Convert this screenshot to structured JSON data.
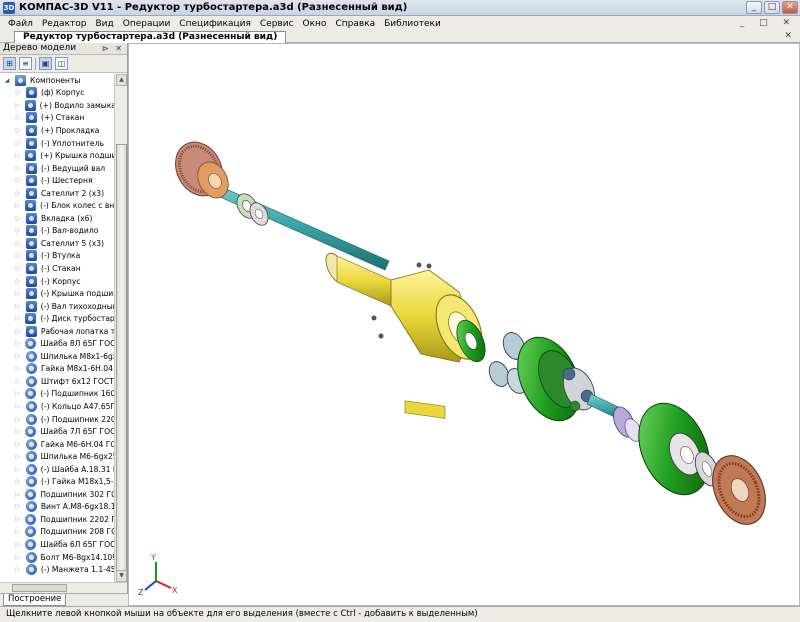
{
  "window": {
    "title": "КОМПАС-3D V11 - Редуктор турбостартера.a3d (Разнесенный вид)",
    "icon_label": "3D",
    "controls": [
      "minimize-icon",
      "maximize-icon",
      "close-icon"
    ]
  },
  "menu": [
    "Файл",
    "Редактор",
    "Вид",
    "Операции",
    "Спецификация",
    "Сервис",
    "Окно",
    "Справка",
    "Библиотеки"
  ],
  "document_tab": {
    "label": "Редуктор турбостартера.a3d (Разнесенный вид)"
  },
  "model_tree": {
    "header": "Дерево модели",
    "root": "Компоненты",
    "items": [
      {
        "label": "(ф) Корпус",
        "icon": "part-icon"
      },
      {
        "label": "(+) Водило замыкающ",
        "icon": "part-icon"
      },
      {
        "label": "(+) Стакан",
        "icon": "part-icon"
      },
      {
        "label": "(+) Прокладка",
        "icon": "part-icon"
      },
      {
        "label": "(-) Уплотнитель",
        "icon": "part-icon"
      },
      {
        "label": "(+) Крышка подшип",
        "icon": "part-icon"
      },
      {
        "label": "(-) Ведущий вал",
        "icon": "part-icon"
      },
      {
        "label": "(-) Шестерня",
        "icon": "part-icon"
      },
      {
        "label": "Сателлит 2 (x3)",
        "icon": "part-icon"
      },
      {
        "label": "(-) Блок колес с внут",
        "icon": "part-icon"
      },
      {
        "label": "Вкладка (x6)",
        "icon": "part-icon"
      },
      {
        "label": "(-) Вал-водило",
        "icon": "part-icon"
      },
      {
        "label": "Сателлит 5 (x3)",
        "icon": "part-icon"
      },
      {
        "label": "(-) Втулка",
        "icon": "part-icon"
      },
      {
        "label": "(-) Стакан",
        "icon": "part-icon"
      },
      {
        "label": "(-) Корпус",
        "icon": "part-icon"
      },
      {
        "label": "(-) Крышка подшип",
        "icon": "part-icon"
      },
      {
        "label": "(-) Вал тихоходный",
        "icon": "part-icon"
      },
      {
        "label": "(-) Диск турбостарт",
        "icon": "part-icon"
      },
      {
        "label": "Рабочая лопатка т",
        "icon": "part-icon"
      },
      {
        "label": "Шайба 8Л 65Г ГОСТ",
        "icon": "standard-part-icon"
      },
      {
        "label": "Шпилька М8х1-6gх",
        "icon": "standard-part-icon"
      },
      {
        "label": "Гайка М8х1-6Н.04",
        "icon": "standard-part-icon"
      },
      {
        "label": "Штифт 6х12 ГОСТ",
        "icon": "standard-part-icon"
      },
      {
        "label": "(-) Подшипник 1602",
        "icon": "standard-part-icon"
      },
      {
        "label": "(-) Кольцо А47.65Г",
        "icon": "standard-part-icon"
      },
      {
        "label": "(-) Подшипник 220",
        "icon": "standard-part-icon"
      },
      {
        "label": "Шайба 7Л 65Г ГОСТ",
        "icon": "standard-part-icon"
      },
      {
        "label": "Гайка М6-6Н.04 ГО",
        "icon": "standard-part-icon"
      },
      {
        "label": "Шпилька М6-6gх25",
        "icon": "standard-part-icon"
      },
      {
        "label": "(-) Шайба А.18.31 Г",
        "icon": "standard-part-icon"
      },
      {
        "label": "(-) Гайка М18х1,5-",
        "icon": "standard-part-icon"
      },
      {
        "label": "Подшипник 302 ГОС",
        "icon": "standard-part-icon"
      },
      {
        "label": "Винт А.М8-6gх18.1",
        "icon": "standard-part-icon"
      },
      {
        "label": "Подшипник 2202 ГО",
        "icon": "standard-part-icon"
      },
      {
        "label": "Подшипник 208 ГОС",
        "icon": "standard-part-icon"
      },
      {
        "label": "Шайба 6Л 65Г ГОСТ",
        "icon": "standard-part-icon"
      },
      {
        "label": "Болт М6-8gх14.109",
        "icon": "standard-part-icon"
      },
      {
        "label": "(-) Манжета 1.1-45",
        "icon": "standard-part-icon"
      }
    ]
  },
  "bottom_tab": "Построение",
  "viewport": {
    "triad": {
      "x": "X",
      "y": "Y",
      "z": "Z"
    },
    "colors": {
      "green": "#1e9e1e",
      "yellow": "#e8d83a",
      "teal": "#3aa7a8",
      "orange": "#d88a52",
      "lavender": "#b8a8d8",
      "bronze": "#c07a56"
    }
  },
  "status": "Щелкните левой кнопкой мыши на объекте для его выделения (вместе с Ctrl - добавить к выделенным)"
}
